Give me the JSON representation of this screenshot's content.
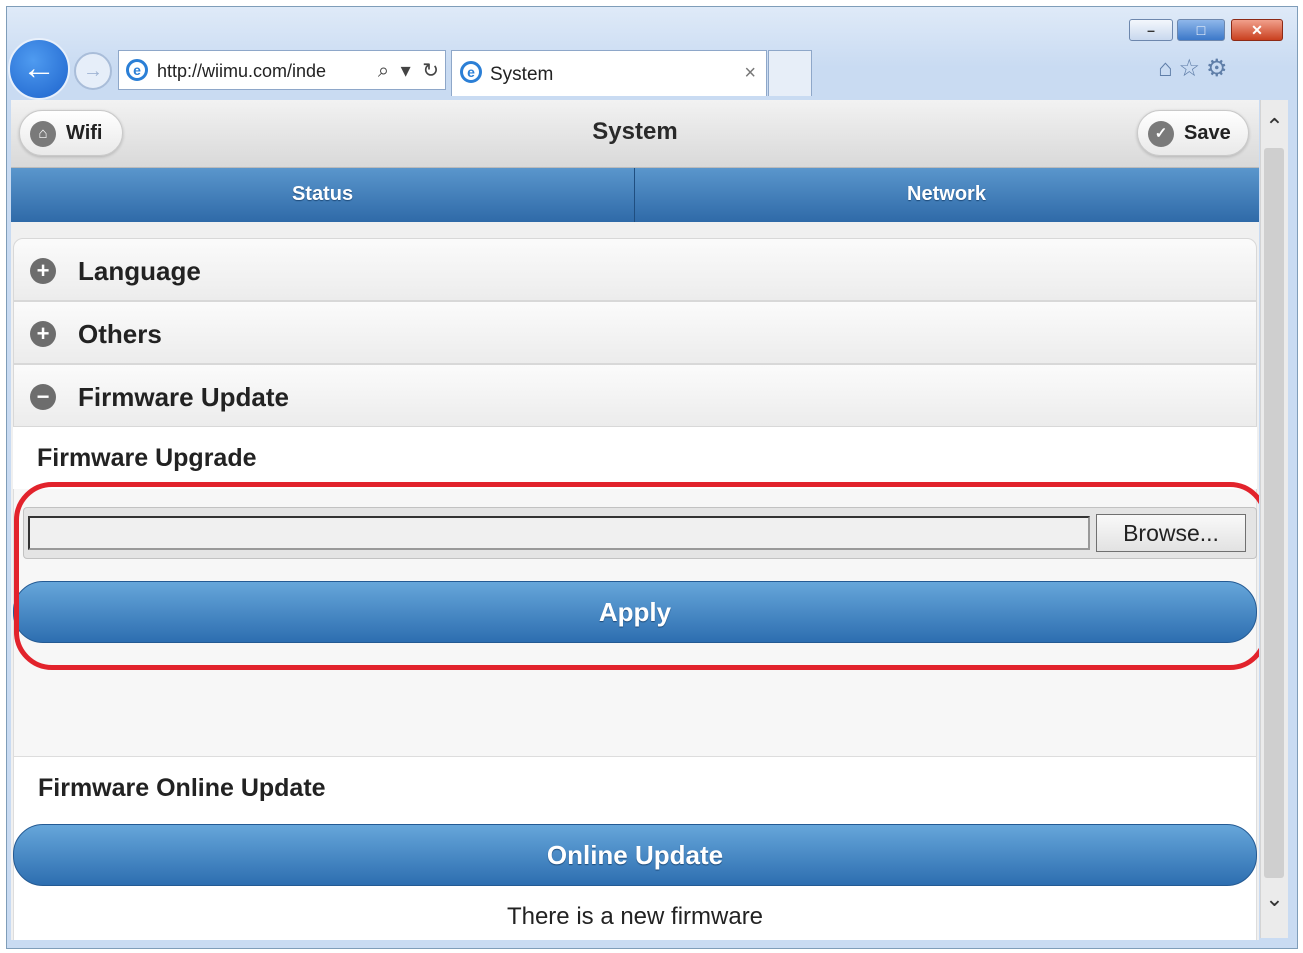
{
  "browser": {
    "address": "http://wiimu.com/inde",
    "tab_title": "System",
    "tab_close": "×"
  },
  "header": {
    "left_button": "Wifi",
    "title": "System",
    "right_button": "Save"
  },
  "navbar": {
    "tabs": [
      "Status",
      "Network"
    ]
  },
  "sections": [
    {
      "label": "Language",
      "state": "collapsed"
    },
    {
      "label": "Others",
      "state": "collapsed"
    },
    {
      "label": "Firmware Update",
      "state": "expanded"
    }
  ],
  "firmware_update": {
    "upgrade_title": "Firmware Upgrade",
    "file_value": "",
    "browse_label": "Browse...",
    "apply_label": "Apply",
    "online_title": "Firmware Online Update",
    "online_button": "Online Update",
    "notice": "There is a new firmware"
  },
  "colors": {
    "accent_blue": "#2d6eb0",
    "highlight_red": "#e2232c"
  }
}
